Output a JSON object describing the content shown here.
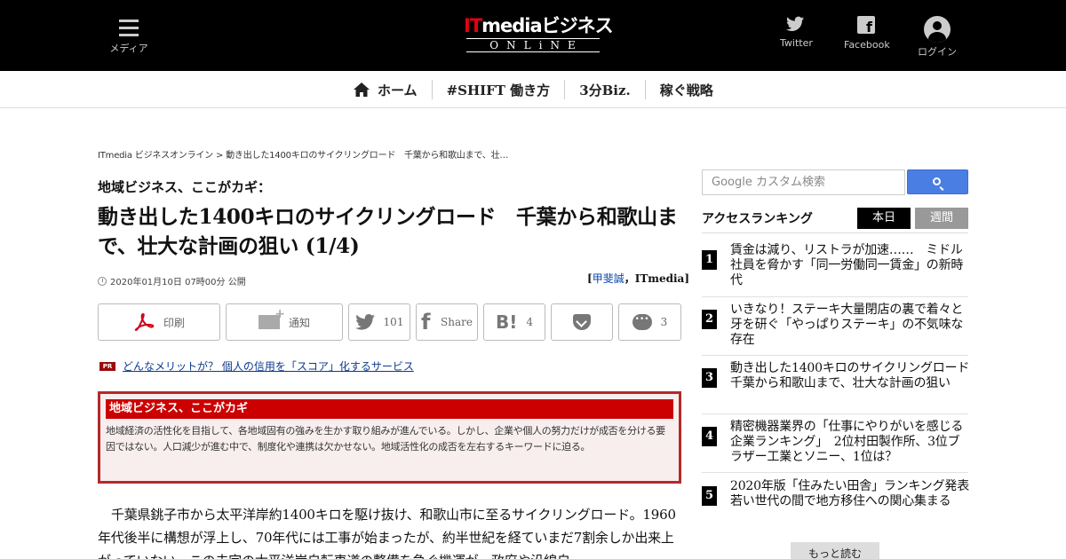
{
  "header": {
    "menu_label": "メディア",
    "logo_top_it": "IT",
    "logo_top_rest": "mediaビジネス",
    "logo_bottom": "ONLiNE",
    "twitter_label": "Twitter",
    "facebook_label": "Facebook",
    "login_label": "ログイン"
  },
  "nav": {
    "items": [
      {
        "label": "ホーム",
        "icon": "home-icon"
      },
      {
        "label": "#SHIFT 働き方"
      },
      {
        "label": "3分Biz."
      },
      {
        "label": "稼ぐ戦略"
      }
    ]
  },
  "breadcrumb": "ITmedia ビジネスオンライン > 動き出した1400キロのサイクリングロード　千葉から和歌山まで、壮…",
  "article": {
    "series": "地域ビジネス、ここがカギ：",
    "title": "動き出した1400キロのサイクリングロード　千葉から和歌山まで、壮大な計画の狙い (1/4)",
    "date": "2020年01月10日 07時00分 公開",
    "author_open": "[",
    "author_link": "甲斐誠",
    "author_rest": "，ITmedia]",
    "share": {
      "print": "印刷",
      "notify": "通知",
      "twitter_count": "101",
      "facebook": "Share",
      "hatena_count": "4",
      "hatena_glyph": "B!",
      "facebook_glyph": "f",
      "comment_count": "3"
    },
    "pr_badge": "PR",
    "pr_link": "どんなメリットが？ 個人の信用を「スコア」化するサービス",
    "box_title": "地域ビジネス、ここがカギ",
    "box_body": "地域経済の活性化を目指して、各地域固有の強みを生かす取り組みが進んでいる。しかし、企業や個人の努力だけが成否を分ける要因ではない。人口減少が進む中で、制度化や連携は欠かせない。地域活性化の成否を左右するキーワードに迫る。",
    "body": "千葉県銚子市から太平洋岸約1400キロを駆け抜け、和歌山市に至るサイクリングロード。1960年代後半に構想が浮上し、70年代には工事が始まったが、約半世紀を経ていまだ7割余しか出来上がっていない。この未完の太平洋岸自転車道の整備を急ぐ機運が、政府や沿線自"
  },
  "sidebar": {
    "search_placeholder": "Google カスタム検索",
    "ranking_title": "アクセスランキング",
    "tab_today": "本日",
    "tab_week": "週間",
    "ranking": [
      {
        "num": "1",
        "title": "賃金は減り、リストラが加速……　ミドル社員を脅かす「同一労働同一賃金」の新時代"
      },
      {
        "num": "2",
        "title": "いきなり！ステーキ大量閉店の裏で着々と牙を研ぐ「やっぱりステーキ」の不気味な存在"
      },
      {
        "num": "3",
        "title": "動き出した1400キロのサイクリングロード　千葉から和歌山まで、壮大な計画の狙い"
      },
      {
        "num": "4",
        "title": "精密機器業界の「仕事にやりがいを感じる企業ランキング」　2位村田製作所、3位ブラザー工業とソニー、1位は？"
      },
      {
        "num": "5",
        "title": "2020年版「住みたい田舎」ランキング発表　若い世代の間で地方移住への関心集まる"
      }
    ],
    "more_label": "もっと読む"
  },
  "colors": {
    "header_bg": "#000000",
    "logo_accent": "#e60012",
    "box_border": "#b32a2a",
    "box_head": "#cc0000",
    "search_button": "#4a7ee3",
    "link": "#0645ad"
  }
}
